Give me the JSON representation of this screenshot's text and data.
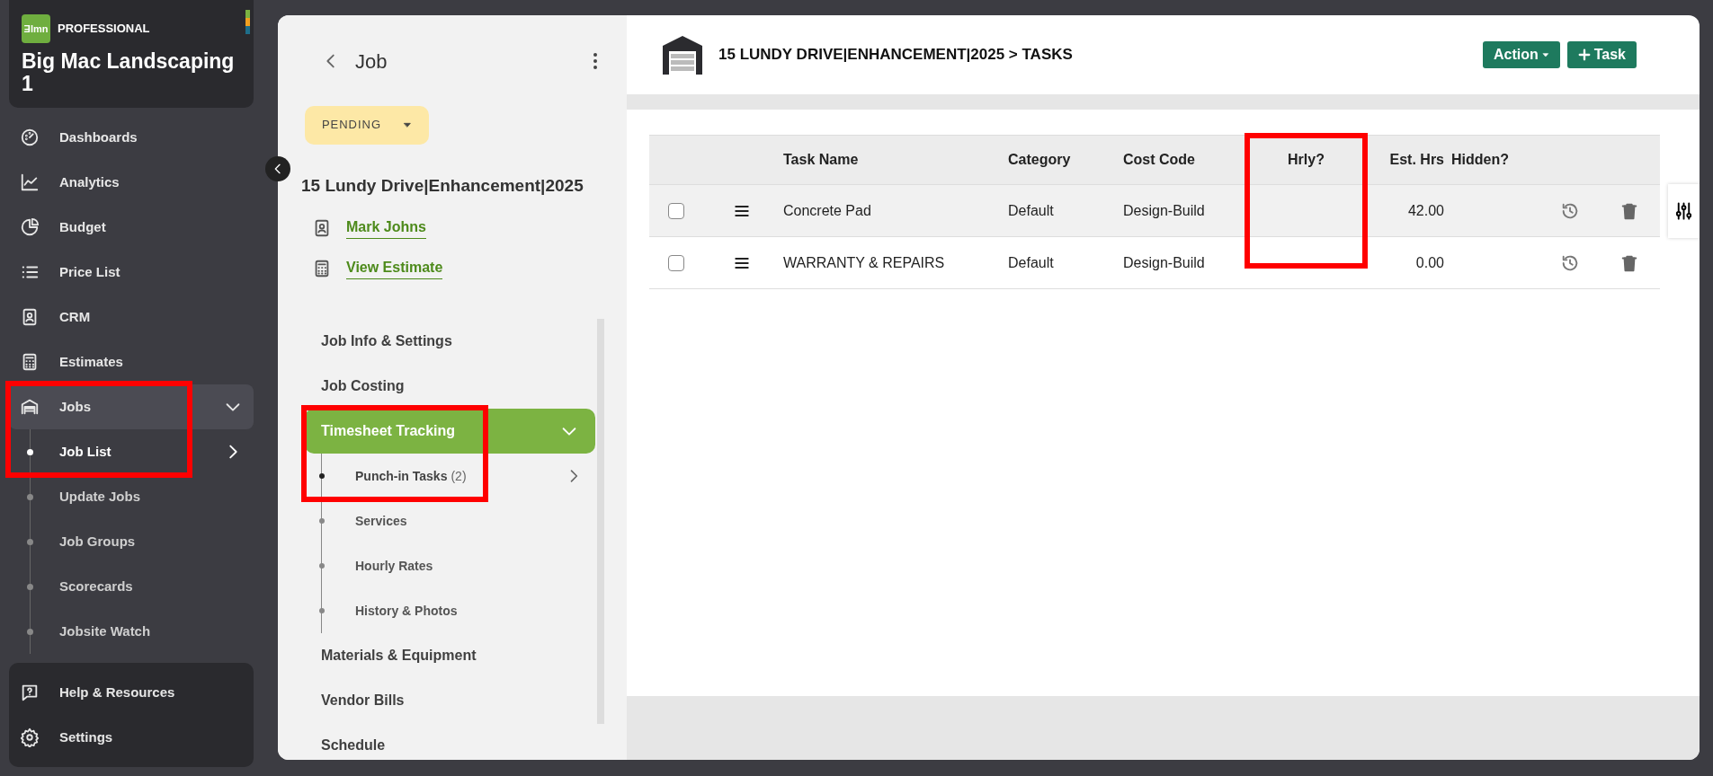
{
  "brand": {
    "logo": "Ǝlmn",
    "tier": "PROFESSIONAL",
    "company": "Big Mac Landscaping 1"
  },
  "sidebar": {
    "items": [
      {
        "label": "Dashboards",
        "selected": false,
        "annotated": false
      },
      {
        "label": "Analytics",
        "selected": false,
        "annotated": false
      },
      {
        "label": "Budget",
        "selected": false,
        "annotated": false
      },
      {
        "label": "Price List",
        "selected": false,
        "annotated": false
      },
      {
        "label": "CRM",
        "selected": false,
        "annotated": false
      },
      {
        "label": "Estimates",
        "selected": false,
        "annotated": false
      },
      {
        "label": "Jobs",
        "selected": true,
        "expanded": true,
        "annotated": true,
        "children": [
          {
            "label": "Job List",
            "selected": true,
            "annotated": true
          },
          {
            "label": "Update Jobs",
            "selected": false,
            "annotated": false
          },
          {
            "label": "Job Groups",
            "selected": false,
            "annotated": false
          },
          {
            "label": "Scorecards",
            "selected": false,
            "annotated": false
          },
          {
            "label": "Jobsite Watch",
            "selected": false,
            "annotated": false
          }
        ]
      }
    ],
    "footer_items": [
      {
        "label": "Help & Resources"
      },
      {
        "label": "Settings"
      }
    ]
  },
  "job_panel": {
    "title": "Job",
    "status": "PENDING",
    "job_name": "15 Lundy Drive|Enhancement|2025",
    "links": [
      {
        "label": "Mark Johns"
      },
      {
        "label": "View Estimate"
      }
    ],
    "menu": [
      {
        "label": "Job Info & Settings",
        "selected": false,
        "annotated": false
      },
      {
        "label": "Job Costing",
        "selected": false,
        "annotated": false
      },
      {
        "label": "Timesheet Tracking",
        "selected": true,
        "expanded": true,
        "annotated": true,
        "children": [
          {
            "label": "Punch-in Tasks",
            "count": "(2)",
            "selected": true,
            "annotated": true
          },
          {
            "label": "Services",
            "selected": false,
            "annotated": false
          },
          {
            "label": "Hourly Rates",
            "selected": false,
            "annotated": false
          },
          {
            "label": "History & Photos",
            "selected": false,
            "annotated": false
          }
        ]
      },
      {
        "label": "Materials & Equipment",
        "selected": false,
        "annotated": false
      },
      {
        "label": "Vendor Bills",
        "selected": false,
        "annotated": false
      },
      {
        "label": "Schedule",
        "selected": false,
        "annotated": false
      }
    ]
  },
  "content": {
    "title": "15 LUNDY DRIVE|ENHANCEMENT|2025 > TASKS",
    "buttons": [
      {
        "label": "Action",
        "kind": "dropdown"
      },
      {
        "label": "Task",
        "kind": "add"
      }
    ]
  },
  "table": {
    "columns": [
      {
        "label": "Task Name"
      },
      {
        "label": "Category"
      },
      {
        "label": "Cost Code"
      },
      {
        "label": "Hrly?",
        "annotated": true
      },
      {
        "label": "Est. Hrs"
      },
      {
        "label": "Hidden?"
      }
    ],
    "rows": [
      {
        "checked": false,
        "highlighted": true,
        "cells": [
          "Concrete Pad",
          "Default",
          "Design-Build",
          "",
          "42.00",
          ""
        ]
      },
      {
        "checked": false,
        "highlighted": false,
        "cells": [
          "WARRANTY & REPAIRS",
          "Default",
          "Design-Build",
          "",
          "0.00",
          ""
        ]
      }
    ]
  }
}
